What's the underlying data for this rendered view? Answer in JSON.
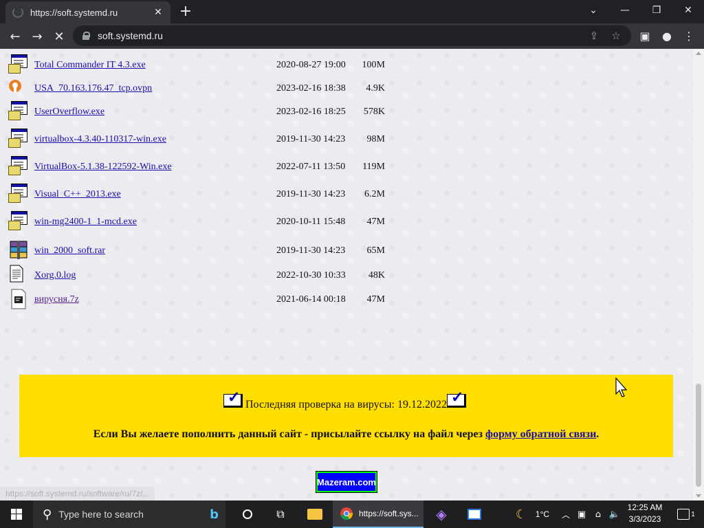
{
  "browser": {
    "tab_title": "https://soft.systemd.ru",
    "url": "soft.systemd.ru"
  },
  "files": [
    {
      "name": "Total Commander IT 4.3.exe",
      "date": "2020-08-27 19:00",
      "size": "100M",
      "icon": "exe-icon"
    },
    {
      "name": "USA_70.163.176.47_tcp.ovpn",
      "date": "2023-02-16 18:38",
      "size": "4.9K",
      "icon": "openvpn-icon"
    },
    {
      "name": "UserOverflow.exe",
      "date": "2023-02-16 18:25",
      "size": "578K",
      "icon": "exe-icon"
    },
    {
      "name": "virtualbox-4.3.40-110317-win.exe",
      "date": "2019-11-30 14:23",
      "size": "98M",
      "icon": "exe-icon"
    },
    {
      "name": "VirtualBox-5.1.38-122592-Win.exe",
      "date": "2022-07-11 13:50",
      "size": "119M",
      "icon": "exe-icon"
    },
    {
      "name": "Visual_C++_2013.exe",
      "date": "2019-11-30 14:23",
      "size": "6.2M",
      "icon": "exe-icon"
    },
    {
      "name": "win-mg2400-1_1-mcd.exe",
      "date": "2020-10-11 15:48",
      "size": "47M",
      "icon": "exe-icon"
    },
    {
      "name": "win_2000_soft.rar",
      "date": "2019-11-30 14:23",
      "size": "65M",
      "icon": "archive-icon"
    },
    {
      "name": "Xorg.0.log",
      "date": "2022-10-30 10:33",
      "size": "48K",
      "icon": "text-file-icon"
    },
    {
      "name": "вирусня.7z",
      "date": "2021-06-14 00:18",
      "size": "47M",
      "icon": "7z-archive-icon"
    }
  ],
  "notice": {
    "virus_check": "Последняя проверка на вирусы: 19.12.2022",
    "submit_text": "Если Вы желаете пополнить данный сайт - присылайте ссылку на файл через ",
    "feedback_link": "форму обратной связи",
    "period": "."
  },
  "badge_text": "Mazeram.com",
  "status_url": "https://soft.systemd.ru/software/ru/7z/...",
  "taskbar": {
    "search_placeholder": "Type here to search",
    "chrome_label": "https://soft.sys...",
    "temperature": "1°C",
    "time": "12:25 AM",
    "date": "3/3/2023",
    "notification_count": "1"
  }
}
